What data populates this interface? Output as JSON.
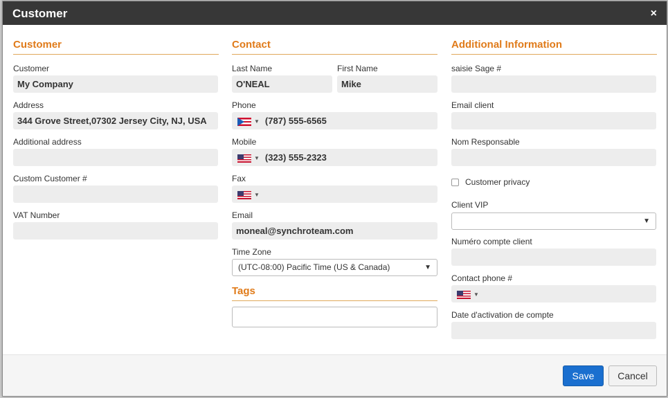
{
  "dialog": {
    "title": "Customer",
    "close_glyph": "×"
  },
  "customer_section": {
    "title": "Customer",
    "customer_label": "Customer",
    "customer_value": "My Company",
    "address_label": "Address",
    "address_value": "344 Grove Street,07302 Jersey City, NJ, USA",
    "additional_address_label": "Additional address",
    "additional_address_value": "",
    "custom_customer_label": "Custom Customer #",
    "custom_customer_value": "",
    "vat_label": "VAT Number",
    "vat_value": ""
  },
  "contact_section": {
    "title": "Contact",
    "last_name_label": "Last Name",
    "last_name_value": "O'NEAL",
    "first_name_label": "First Name",
    "first_name_value": "Mike",
    "phone_label": "Phone",
    "phone_flag": "flag-pr-icon",
    "phone_value": "(787) 555-6565",
    "mobile_label": "Mobile",
    "mobile_flag": "flag-us-icon",
    "mobile_value": "(323) 555-2323",
    "fax_label": "Fax",
    "fax_flag": "flag-us-icon",
    "fax_value": "",
    "email_label": "Email",
    "email_value": "moneal@synchroteam.com",
    "timezone_label": "Time Zone",
    "timezone_value": "(UTC-08:00) Pacific Time (US & Canada)"
  },
  "tags_section": {
    "title": "Tags",
    "value": ""
  },
  "additional_section": {
    "title": "Additional Information",
    "saisie_sage_label": "saisie Sage #",
    "saisie_sage_value": "",
    "email_client_label": "Email client",
    "email_client_value": "",
    "nom_responsable_label": "Nom Responsable",
    "nom_responsable_value": "",
    "customer_privacy_label": "Customer privacy",
    "customer_privacy_checked": false,
    "client_vip_label": "Client VIP",
    "client_vip_value": "",
    "numero_compte_label": "Numéro compte client",
    "numero_compte_value": "",
    "contact_phone_label": "Contact phone #",
    "contact_phone_flag": "flag-us-icon",
    "contact_phone_value": "",
    "date_activation_label": "Date d'activation de compte",
    "date_activation_value": ""
  },
  "footer": {
    "save_label": "Save",
    "cancel_label": "Cancel"
  },
  "colors": {
    "titlebar": "#373737",
    "section_title": "#e07b1a",
    "save_button": "#1a6fcf",
    "input_bg": "#ededed"
  }
}
